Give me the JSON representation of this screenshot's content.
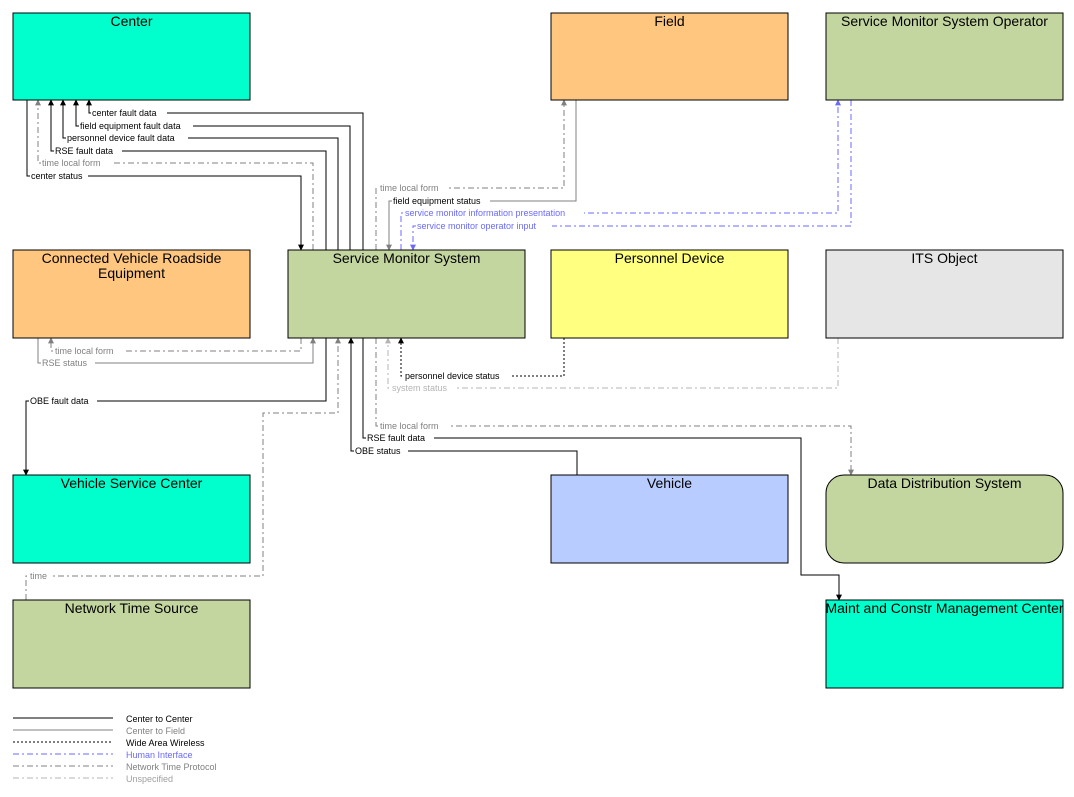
{
  "colors": {
    "center": "#00ffcc",
    "field": "#ffc680",
    "operator": "#c4d6a0",
    "service_monitor": "#c4d6a0",
    "personnel_device": "#ffff80",
    "its_object": "#e6e6e6",
    "vehicle": "#b8ccff",
    "data_distribution": "#c4d6a0",
    "network_time_source": "#c4d6a0",
    "line_black": "#000000",
    "line_gray": "#808080",
    "line_blue": "#6a6aff",
    "line_light": "#b4b4b4"
  },
  "boxes": {
    "center": "Center",
    "field": "Field",
    "operator": "Service Monitor System Operator",
    "cvre_line1": "Connected Vehicle Roadside",
    "cvre_line2": "Equipment",
    "service_monitor": "Service Monitor System",
    "personnel_device": "Personnel Device",
    "its_object": "ITS Object",
    "vehicle_service_center": "Vehicle Service Center",
    "vehicle": "Vehicle",
    "data_distribution": "Data Distribution System",
    "network_time_source": "Network Time Source",
    "maint_constr": "Maint and Constr Management Center"
  },
  "flows": {
    "center_fault_data": "center fault data",
    "field_equipment_fault_data": "field equipment fault data",
    "personnel_device_fault_data": "personnel device fault data",
    "rse_fault_data_center": "RSE fault data",
    "time_local_form_center": "time local form",
    "center_status": "center status",
    "time_local_form_field": "time local form",
    "field_equipment_status": "field equipment status",
    "service_monitor_information_presentation": "service monitor information presentation",
    "service_monitor_operator_input": "service monitor operator input",
    "time_local_form_cvre": "time local form",
    "rse_status": "RSE status",
    "personnel_device_status": "personnel device status",
    "system_status": "system status",
    "obe_fault_data": "OBE fault data",
    "time_local_form_dds": "time local form",
    "rse_fault_data_maint": "RSE fault data",
    "obe_status": "OBE status",
    "time": "time"
  },
  "legend": {
    "center_to_center": "Center to Center",
    "center_to_field": "Center to Field",
    "wide_area_wireless": "Wide Area Wireless",
    "human_interface": "Human Interface",
    "network_time_protocol": "Network Time Protocol",
    "unspecified": "Unspecified"
  }
}
